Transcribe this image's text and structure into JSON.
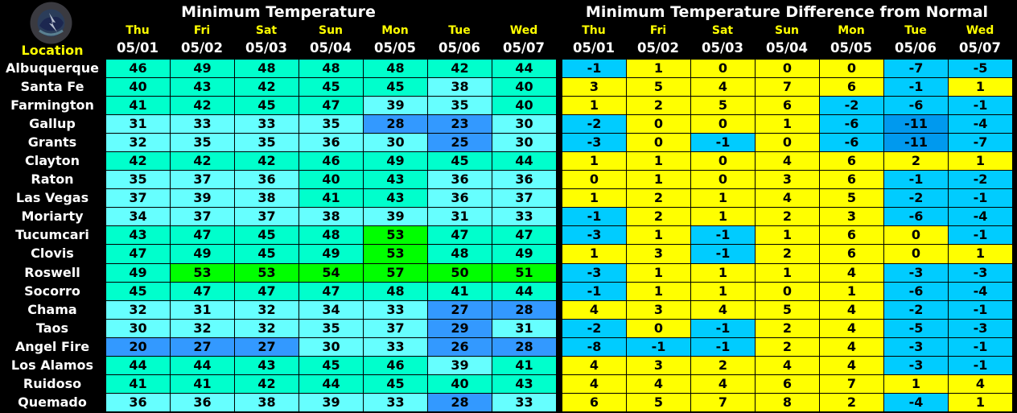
{
  "logo": {
    "icon": "nws-logo-icon",
    "label": "National Weather Service"
  },
  "header": {
    "location_label": "Location",
    "left_title": "Minimum Temperature",
    "right_title": "Minimum Temperature Difference from Normal"
  },
  "days": [
    {
      "day": "Thu",
      "date": "05/01"
    },
    {
      "day": "Fri",
      "date": "05/02"
    },
    {
      "day": "Sat",
      "date": "05/03"
    },
    {
      "day": "Sun",
      "date": "05/04"
    },
    {
      "day": "Mon",
      "date": "05/05"
    },
    {
      "day": "Tue",
      "date": "05/06"
    },
    {
      "day": "Wed",
      "date": "05/07"
    }
  ],
  "temp_colors": {
    "lt30": "#3399ff",
    "30s": "#66ffff",
    "40s": "#00ffcc",
    "50s": "#00ff00"
  },
  "diff_colors": {
    "le_minus11": "#0099ee",
    "negative": "#00ccff",
    "nonnegative": "#ffff00"
  },
  "locations": [
    {
      "name": "Albuquerque",
      "temps": [
        46,
        49,
        48,
        48,
        48,
        42,
        44
      ],
      "diffs": [
        -1,
        1,
        0,
        0,
        0,
        -7,
        -5
      ]
    },
    {
      "name": "Santa Fe",
      "temps": [
        40,
        43,
        42,
        45,
        45,
        38,
        40
      ],
      "diffs": [
        3,
        5,
        4,
        7,
        6,
        -1,
        1
      ]
    },
    {
      "name": "Farmington",
      "temps": [
        41,
        42,
        45,
        47,
        39,
        35,
        40
      ],
      "diffs": [
        1,
        2,
        5,
        6,
        -2,
        -6,
        -1
      ]
    },
    {
      "name": "Gallup",
      "temps": [
        31,
        33,
        33,
        35,
        28,
        23,
        30
      ],
      "diffs": [
        -2,
        0,
        0,
        1,
        -6,
        -11,
        -4
      ]
    },
    {
      "name": "Grants",
      "temps": [
        32,
        35,
        35,
        36,
        30,
        25,
        30
      ],
      "diffs": [
        -3,
        0,
        -1,
        0,
        -6,
        -11,
        -7
      ]
    },
    {
      "name": "Clayton",
      "temps": [
        42,
        42,
        42,
        46,
        49,
        45,
        44
      ],
      "diffs": [
        1,
        1,
        0,
        4,
        6,
        2,
        1
      ]
    },
    {
      "name": "Raton",
      "temps": [
        35,
        37,
        36,
        40,
        43,
        36,
        36
      ],
      "diffs": [
        0,
        1,
        0,
        3,
        6,
        -1,
        -2
      ]
    },
    {
      "name": "Las Vegas",
      "temps": [
        37,
        39,
        38,
        41,
        43,
        36,
        37
      ],
      "diffs": [
        1,
        2,
        1,
        4,
        5,
        -2,
        -1
      ]
    },
    {
      "name": "Moriarty",
      "temps": [
        34,
        37,
        37,
        38,
        39,
        31,
        33
      ],
      "diffs": [
        -1,
        2,
        1,
        2,
        3,
        -6,
        -4
      ]
    },
    {
      "name": "Tucumcari",
      "temps": [
        43,
        47,
        45,
        48,
        53,
        47,
        47
      ],
      "diffs": [
        -3,
        1,
        -1,
        1,
        6,
        0,
        -1
      ]
    },
    {
      "name": "Clovis",
      "temps": [
        47,
        49,
        45,
        49,
        53,
        48,
        49
      ],
      "diffs": [
        1,
        3,
        -1,
        2,
        6,
        0,
        1
      ]
    },
    {
      "name": "Roswell",
      "temps": [
        49,
        53,
        53,
        54,
        57,
        50,
        51
      ],
      "diffs": [
        -3,
        1,
        1,
        1,
        4,
        -3,
        -3
      ]
    },
    {
      "name": "Socorro",
      "temps": [
        45,
        47,
        47,
        47,
        48,
        41,
        44
      ],
      "diffs": [
        -1,
        1,
        1,
        0,
        1,
        -6,
        -4
      ]
    },
    {
      "name": "Chama",
      "temps": [
        32,
        31,
        32,
        34,
        33,
        27,
        28
      ],
      "diffs": [
        4,
        3,
        4,
        5,
        4,
        -2,
        -1
      ]
    },
    {
      "name": "Taos",
      "temps": [
        30,
        32,
        32,
        35,
        37,
        29,
        31
      ],
      "diffs": [
        -2,
        0,
        -1,
        2,
        4,
        -5,
        -3
      ]
    },
    {
      "name": "Angel Fire",
      "temps": [
        20,
        27,
        27,
        30,
        33,
        26,
        28
      ],
      "diffs": [
        -8,
        -1,
        -1,
        2,
        4,
        -3,
        -1
      ]
    },
    {
      "name": "Los Alamos",
      "temps": [
        44,
        44,
        43,
        45,
        46,
        39,
        41
      ],
      "diffs": [
        4,
        3,
        2,
        4,
        4,
        -3,
        -1
      ]
    },
    {
      "name": "Ruidoso",
      "temps": [
        41,
        41,
        42,
        44,
        45,
        40,
        43
      ],
      "diffs": [
        4,
        4,
        4,
        6,
        7,
        1,
        4
      ]
    },
    {
      "name": "Quemado",
      "temps": [
        36,
        36,
        38,
        39,
        33,
        28,
        33
      ],
      "diffs": [
        6,
        5,
        7,
        8,
        2,
        -4,
        1
      ]
    }
  ]
}
